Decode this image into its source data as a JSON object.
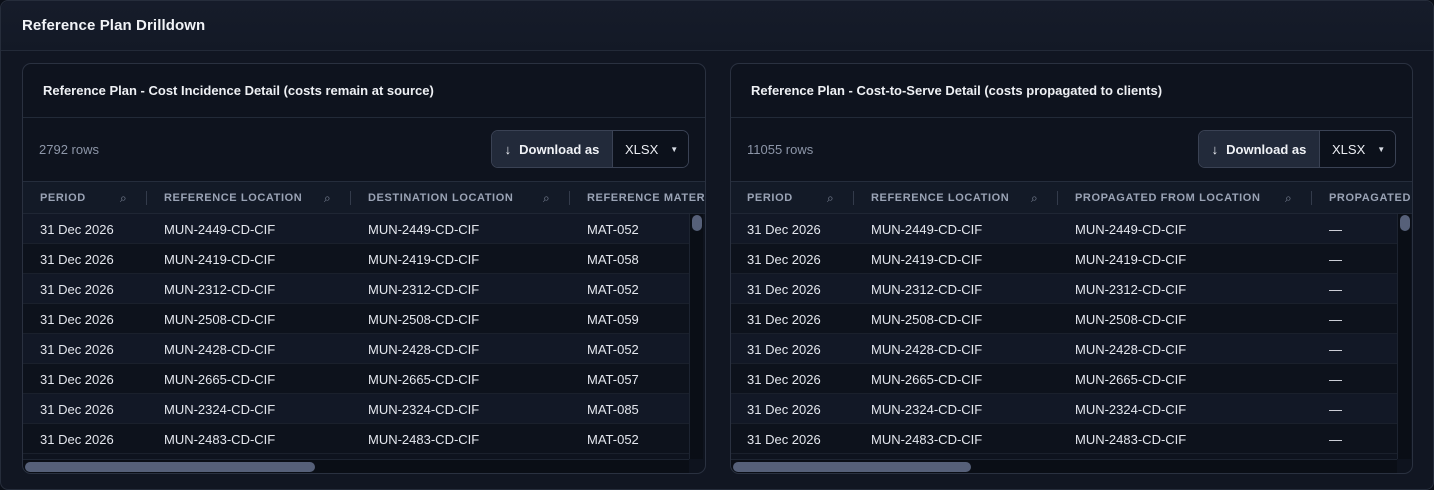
{
  "page": {
    "title": "Reference Plan Drilldown"
  },
  "left_panel": {
    "title": "Reference Plan - Cost Incidence Detail (costs remain at source)",
    "row_count": "2792 rows",
    "download_label": "Download as",
    "format": "XLSX",
    "columns": [
      "PERIOD",
      "REFERENCE LOCATION",
      "DESTINATION LOCATION",
      "REFERENCE MATERIA"
    ],
    "rows": [
      [
        "31 Dec 2026",
        "MUN-2449-CD-CIF",
        "MUN-2449-CD-CIF",
        "MAT-052"
      ],
      [
        "31 Dec 2026",
        "MUN-2419-CD-CIF",
        "MUN-2419-CD-CIF",
        "MAT-058"
      ],
      [
        "31 Dec 2026",
        "MUN-2312-CD-CIF",
        "MUN-2312-CD-CIF",
        "MAT-052"
      ],
      [
        "31 Dec 2026",
        "MUN-2508-CD-CIF",
        "MUN-2508-CD-CIF",
        "MAT-059"
      ],
      [
        "31 Dec 2026",
        "MUN-2428-CD-CIF",
        "MUN-2428-CD-CIF",
        "MAT-052"
      ],
      [
        "31 Dec 2026",
        "MUN-2665-CD-CIF",
        "MUN-2665-CD-CIF",
        "MAT-057"
      ],
      [
        "31 Dec 2026",
        "MUN-2324-CD-CIF",
        "MUN-2324-CD-CIF",
        "MAT-085"
      ],
      [
        "31 Dec 2026",
        "MUN-2483-CD-CIF",
        "MUN-2483-CD-CIF",
        "MAT-052"
      ]
    ]
  },
  "right_panel": {
    "title": "Reference Plan - Cost-to-Serve Detail (costs propagated to clients)",
    "row_count": "11055 rows",
    "download_label": "Download as",
    "format": "XLSX",
    "columns": [
      "PERIOD",
      "REFERENCE LOCATION",
      "PROPAGATED FROM LOCATION",
      "PROPAGATED"
    ],
    "rows": [
      [
        "31 Dec 2026",
        "MUN-2449-CD-CIF",
        "MUN-2449-CD-CIF",
        "—"
      ],
      [
        "31 Dec 2026",
        "MUN-2419-CD-CIF",
        "MUN-2419-CD-CIF",
        "—"
      ],
      [
        "31 Dec 2026",
        "MUN-2312-CD-CIF",
        "MUN-2312-CD-CIF",
        "—"
      ],
      [
        "31 Dec 2026",
        "MUN-2508-CD-CIF",
        "MUN-2508-CD-CIF",
        "—"
      ],
      [
        "31 Dec 2026",
        "MUN-2428-CD-CIF",
        "MUN-2428-CD-CIF",
        "—"
      ],
      [
        "31 Dec 2026",
        "MUN-2665-CD-CIF",
        "MUN-2665-CD-CIF",
        "—"
      ],
      [
        "31 Dec 2026",
        "MUN-2324-CD-CIF",
        "MUN-2324-CD-CIF",
        "—"
      ],
      [
        "31 Dec 2026",
        "MUN-2483-CD-CIF",
        "MUN-2483-CD-CIF",
        "—"
      ]
    ]
  },
  "icons": {
    "download": "arrow-down-icon",
    "dropdown": "caret-down-icon",
    "column_search": "search-icon"
  },
  "colors": {
    "background": "#0b0f18",
    "panel": "#0e131e",
    "button": "#222a3a",
    "scroll_thumb": "#566079"
  }
}
